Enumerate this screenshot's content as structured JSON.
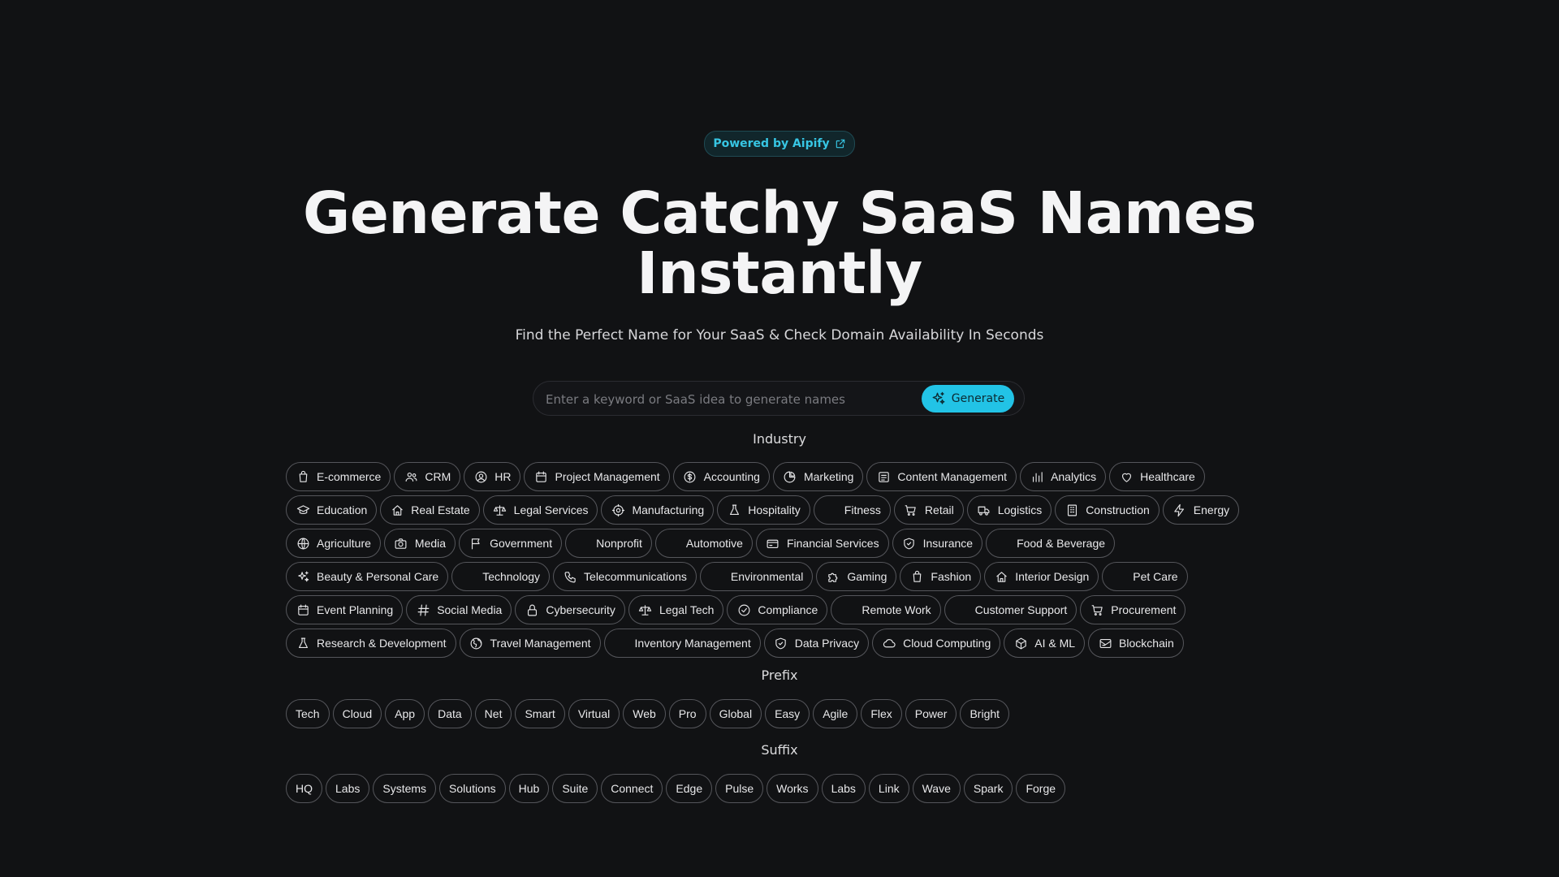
{
  "badge": {
    "label": "Powered by Aipify"
  },
  "hero": {
    "title_line1": "Generate Catchy SaaS Names",
    "title_line2": "Instantly"
  },
  "subtitle": "Find the Perfect Name for Your SaaS & Check Domain Availability In Seconds",
  "search": {
    "placeholder": "Enter a keyword or SaaS idea to generate names",
    "button_label": "Generate"
  },
  "sections": {
    "industry": "Industry",
    "prefix": "Prefix",
    "suffix": "Suffix"
  },
  "industry": [
    {
      "label": "E-commerce",
      "icon": "bag"
    },
    {
      "label": "CRM",
      "icon": "users"
    },
    {
      "label": "HR",
      "icon": "user-circle"
    },
    {
      "label": "Project Management",
      "icon": "calendar"
    },
    {
      "label": "Accounting",
      "icon": "dollar"
    },
    {
      "label": "Marketing",
      "icon": "pie"
    },
    {
      "label": "Content Management",
      "icon": "doc"
    },
    {
      "label": "Analytics",
      "icon": "bars"
    },
    {
      "label": "Healthcare",
      "icon": "heart"
    },
    {
      "label": "Education",
      "icon": "cap"
    },
    {
      "label": "Real Estate",
      "icon": "home"
    },
    {
      "label": "Legal Services",
      "icon": "scale"
    },
    {
      "label": "Manufacturing",
      "icon": "gear"
    },
    {
      "label": "Hospitality",
      "icon": "flask"
    },
    {
      "label": "Fitness",
      "icon": "none"
    },
    {
      "label": "Retail",
      "icon": "cart"
    },
    {
      "label": "Logistics",
      "icon": "truck"
    },
    {
      "label": "Construction",
      "icon": "building"
    },
    {
      "label": "Energy",
      "icon": "bolt"
    },
    {
      "label": "Agriculture",
      "icon": "globe"
    },
    {
      "label": "Media",
      "icon": "camera"
    },
    {
      "label": "Government",
      "icon": "flag"
    },
    {
      "label": "Nonprofit",
      "icon": "none"
    },
    {
      "label": "Automotive",
      "icon": "none"
    },
    {
      "label": "Financial Services",
      "icon": "card"
    },
    {
      "label": "Insurance",
      "icon": "shield"
    },
    {
      "label": "Food & Beverage",
      "icon": "none"
    },
    {
      "label": "Beauty & Personal Care",
      "icon": "sparkle"
    },
    {
      "label": "Technology",
      "icon": "none"
    },
    {
      "label": "Telecommunications",
      "icon": "phone"
    },
    {
      "label": "Environmental",
      "icon": "none"
    },
    {
      "label": "Gaming",
      "icon": "puzzle"
    },
    {
      "label": "Fashion",
      "icon": "bag"
    },
    {
      "label": "Interior Design",
      "icon": "home"
    },
    {
      "label": "Pet Care",
      "icon": "none"
    },
    {
      "label": "Event Planning",
      "icon": "calendar"
    },
    {
      "label": "Social Media",
      "icon": "hash"
    },
    {
      "label": "Cybersecurity",
      "icon": "lock"
    },
    {
      "label": "Legal Tech",
      "icon": "scale"
    },
    {
      "label": "Compliance",
      "icon": "check-circle"
    },
    {
      "label": "Remote Work",
      "icon": "none"
    },
    {
      "label": "Customer Support",
      "icon": "none"
    },
    {
      "label": "Procurement",
      "icon": "cart"
    },
    {
      "label": "Research & Development",
      "icon": "flask"
    },
    {
      "label": "Travel Management",
      "icon": "globe2"
    },
    {
      "label": "Inventory Management",
      "icon": "none"
    },
    {
      "label": "Data Privacy",
      "icon": "shield"
    },
    {
      "label": "Cloud Computing",
      "icon": "cloud"
    },
    {
      "label": "AI & ML",
      "icon": "cube"
    },
    {
      "label": "Blockchain",
      "icon": "mail"
    }
  ],
  "prefix": [
    "Tech",
    "Cloud",
    "App",
    "Data",
    "Net",
    "Smart",
    "Virtual",
    "Web",
    "Pro",
    "Global",
    "Easy",
    "Agile",
    "Flex",
    "Power",
    "Bright"
  ],
  "suffix": [
    "HQ",
    "Labs",
    "Systems",
    "Solutions",
    "Hub",
    "Suite",
    "Connect",
    "Edge",
    "Pulse",
    "Works",
    "Labs",
    "Link",
    "Wave",
    "Spark",
    "Forge"
  ]
}
